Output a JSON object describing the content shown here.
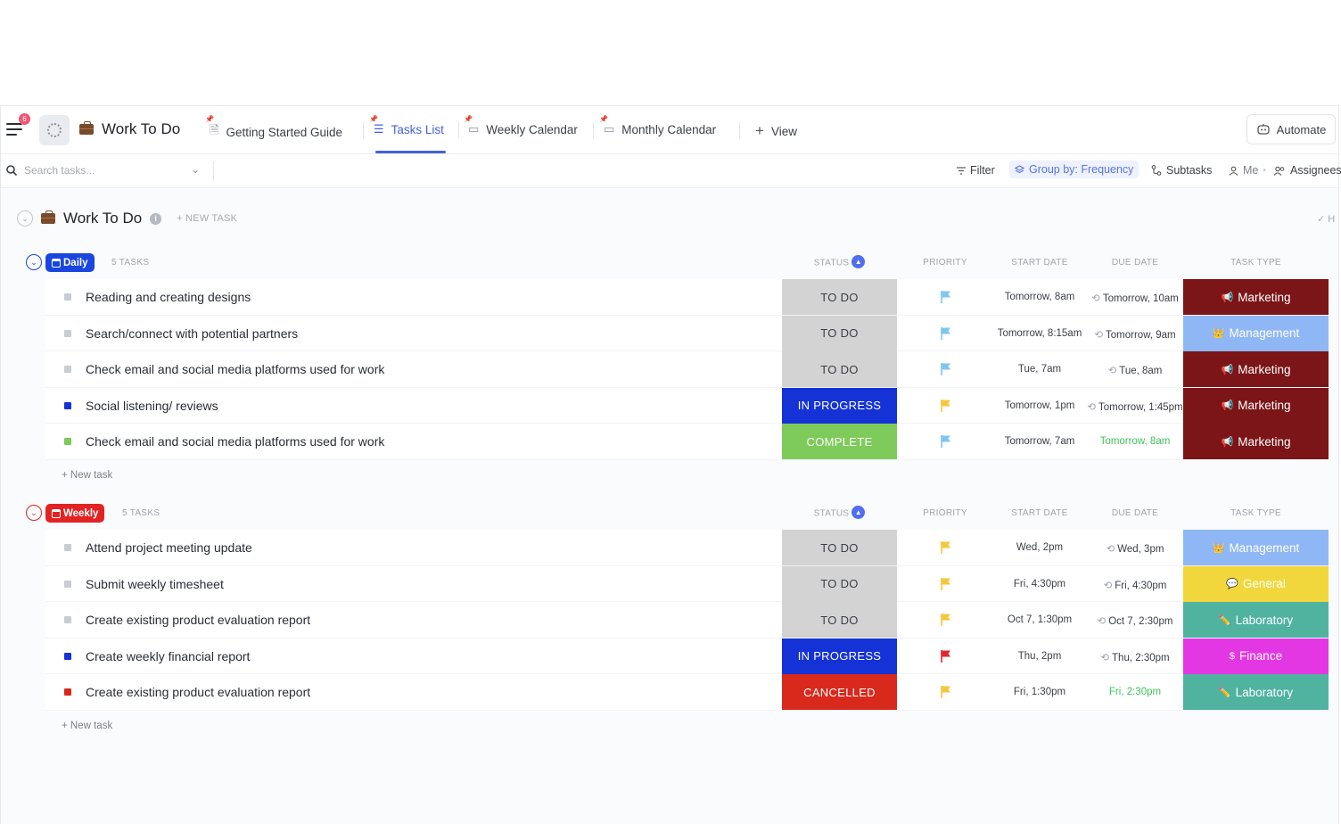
{
  "header": {
    "notification_count": "6",
    "list_title": "Work To Do",
    "tabs": [
      {
        "label": "Getting Started Guide",
        "icon": "doc-icon"
      },
      {
        "label": "Tasks List",
        "icon": "list-icon",
        "active": true
      },
      {
        "label": "Weekly Calendar",
        "icon": "calendar-icon"
      },
      {
        "label": "Monthly Calendar",
        "icon": "calendar-icon"
      }
    ],
    "add_view_label": "View",
    "automate_label": "Automate"
  },
  "toolbar": {
    "search_placeholder": "Search tasks...",
    "filter_label": "Filter",
    "group_label": "Group by: Frequency",
    "subtasks_label": "Subtasks",
    "me_label": "Me",
    "assignees_label": "Assignees"
  },
  "list": {
    "name": "Work To Do",
    "new_task_label": "+ NEW TASK"
  },
  "columns": {
    "status": "STATUS",
    "priority": "PRIORITY",
    "start_date": "START DATE",
    "due_date": "DUE DATE",
    "task_type": "TASK TYPE"
  },
  "colors": {
    "todo": "#d3d3d3",
    "in_progress": "#1432d6",
    "complete": "#7ecb5c",
    "cancelled": "#d9291d",
    "marketing": "#7b1517",
    "management": "#8fb7f5",
    "general": "#f2d73c",
    "laboratory": "#4fb3a0",
    "finance": "#e437e4",
    "daily": "#1a46e0",
    "weekly": "#e32323"
  },
  "groups": [
    {
      "label": "Daily",
      "count": "5 TASKS",
      "new_task": "+ New task",
      "tasks": [
        {
          "name": "Reading and creating designs",
          "status": "TO DO",
          "priority": "low",
          "start": "Tomorrow, 8am",
          "due": "Tomorrow, 10am",
          "due_green": false,
          "type": "Marketing",
          "type_icon": "megaphone-icon"
        },
        {
          "name": "Search/connect with potential partners",
          "status": "TO DO",
          "priority": "low",
          "start": "Tomorrow, 8:15am",
          "due": "Tomorrow, 9am",
          "due_green": false,
          "type": "Management",
          "type_icon": "crown-icon"
        },
        {
          "name": "Check email and social media platforms used for work",
          "status": "TO DO",
          "priority": "low",
          "start": "Tue, 7am",
          "due": "Tue, 8am",
          "due_green": false,
          "type": "Marketing",
          "type_icon": "megaphone-icon"
        },
        {
          "name": "Social listening/ reviews",
          "status": "IN PROGRESS",
          "priority": "normal",
          "start": "Tomorrow, 1pm",
          "due": "Tomorrow, 1:45pm",
          "due_green": false,
          "type": "Marketing",
          "type_icon": "megaphone-icon"
        },
        {
          "name": "Check email and social media platforms used for work",
          "status": "COMPLETE",
          "priority": "low",
          "start": "Tomorrow, 7am",
          "due": "Tomorrow, 8am",
          "due_green": true,
          "type": "Marketing",
          "type_icon": "megaphone-icon"
        }
      ]
    },
    {
      "label": "Weekly",
      "count": "5 TASKS",
      "new_task": "+ New task",
      "tasks": [
        {
          "name": "Attend project meeting update",
          "status": "TO DO",
          "priority": "normal",
          "start": "Wed, 2pm",
          "due": "Wed, 3pm",
          "due_green": false,
          "type": "Management",
          "type_icon": "crown-icon"
        },
        {
          "name": "Submit weekly timesheet",
          "status": "TO DO",
          "priority": "normal",
          "start": "Fri, 4:30pm",
          "due": "Fri, 4:30pm",
          "due_green": false,
          "type": "General",
          "type_icon": "speech-bubble-icon"
        },
        {
          "name": "Create existing product evaluation report",
          "status": "TO DO",
          "priority": "normal",
          "start": "Oct 7, 1:30pm",
          "due": "Oct 7, 2:30pm",
          "due_green": false,
          "type": "Laboratory",
          "type_icon": "pencil-icon"
        },
        {
          "name": "Create weekly financial report",
          "status": "IN PROGRESS",
          "priority": "urgent",
          "start": "Thu, 2pm",
          "due": "Thu, 2:30pm",
          "due_green": false,
          "type": "Finance",
          "type_icon": "dollar-icon"
        },
        {
          "name": "Create existing product evaluation report",
          "status": "CANCELLED",
          "priority": "normal",
          "start": "Fri, 1:30pm",
          "due": "Fri, 2:30pm",
          "due_green": true,
          "type": "Laboratory",
          "type_icon": "pencil-icon"
        }
      ]
    }
  ]
}
